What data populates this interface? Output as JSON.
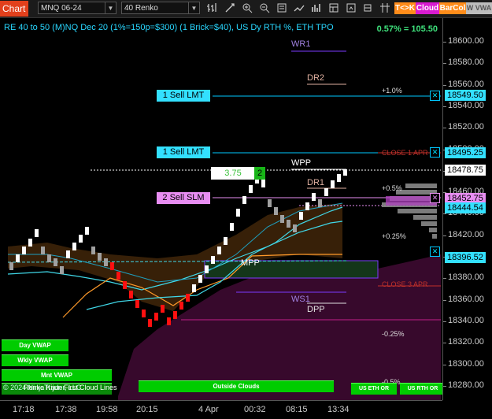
{
  "toolbar": {
    "chart_tab": "Chart",
    "instrument": "MNQ 06-24",
    "bar_type": "40 Renko",
    "buttons": [
      {
        "label": "T<>K",
        "color": "#ff8c1a"
      },
      {
        "label": "Cloud",
        "color": "#d81bd0"
      },
      {
        "label": "BarCol",
        "color": "#ff8c1a"
      },
      {
        "label": "W VWA",
        "color": "#bdbdbd"
      }
    ]
  },
  "chart": {
    "title": "RE 40 to 50 (M)NQ Dec 20 (1%=150p=$300) (1 Brick=$40), US Dy RTH %, ETH TPO",
    "pct_change": "0.57% = 105.50",
    "colors": {
      "up": "#ffffff",
      "down": "#ff1010",
      "neutral": "#a0a0a0",
      "vwap": "#40d8e8",
      "cloud_brown": "#3a2208",
      "cloud_purple": "#3a0a2e"
    }
  },
  "orders": [
    {
      "label": "1 Sell LMT",
      "price": "18549.50",
      "type": "lmt"
    },
    {
      "label": "1 Sell LMT",
      "price": "18495.25",
      "type": "lmt"
    },
    {
      "label": "2 Sell SLM",
      "price": "18452.75",
      "type": "slm"
    }
  ],
  "position_box": {
    "value": "3.75",
    "qty": "2"
  },
  "levels": {
    "wr1": "WR1",
    "dr2": "DR2",
    "wpp": "WPP",
    "dr1": "DR1",
    "mpp": "MPP",
    "ws1": "WS1",
    "dpp": "DPP",
    "plus_1": "+1.0%",
    "plus_05": "+0.5%",
    "plus_025": "+0.25%",
    "minus_025": "-0.25%",
    "minus_05": "-0.5%",
    "close_1_apr": "CLOSE 1 APR",
    "close_3_apr": "CLOSE 3 APR"
  },
  "left_buttons": {
    "day_vwap": "Day VWAP",
    "wkly_vwap": "Wkly VWAP",
    "mnt_vwap": "Mnt VWAP",
    "watermark": "© 2024 NinjaTrader, LLC",
    "heiken": "Renko Kijun First Cloud Lines",
    "outside_clouds": "Outside Clouds",
    "us_eth_or": "US ETH OR",
    "us_rth_or": "US RTH OR"
  },
  "price_axis": {
    "ticks": [
      "18600.00",
      "18580.00",
      "18560.00",
      "18540.00",
      "18520.00",
      "18500.00",
      "18480.00",
      "18460.00",
      "18440.00",
      "18420.00",
      "18400.00",
      "18380.00",
      "18360.00",
      "18340.00",
      "18320.00",
      "18300.00",
      "18280.00"
    ],
    "markers": [
      {
        "text": "18549.50",
        "color": "#33e0ff"
      },
      {
        "text": "18495.25",
        "color": "#33e0ff"
      },
      {
        "text": "18478.75",
        "color": "#ffffff"
      },
      {
        "text": "18452.75",
        "color": "#e88ef2"
      },
      {
        "text": "18444.54",
        "color": "#33e0ff"
      },
      {
        "text": "18396.52",
        "color": "#33e0ff"
      }
    ]
  },
  "time_axis": [
    "17:18",
    "17:38",
    "19:58",
    "20:15",
    "4 Apr",
    "00:32",
    "08:15",
    "13:34"
  ]
}
